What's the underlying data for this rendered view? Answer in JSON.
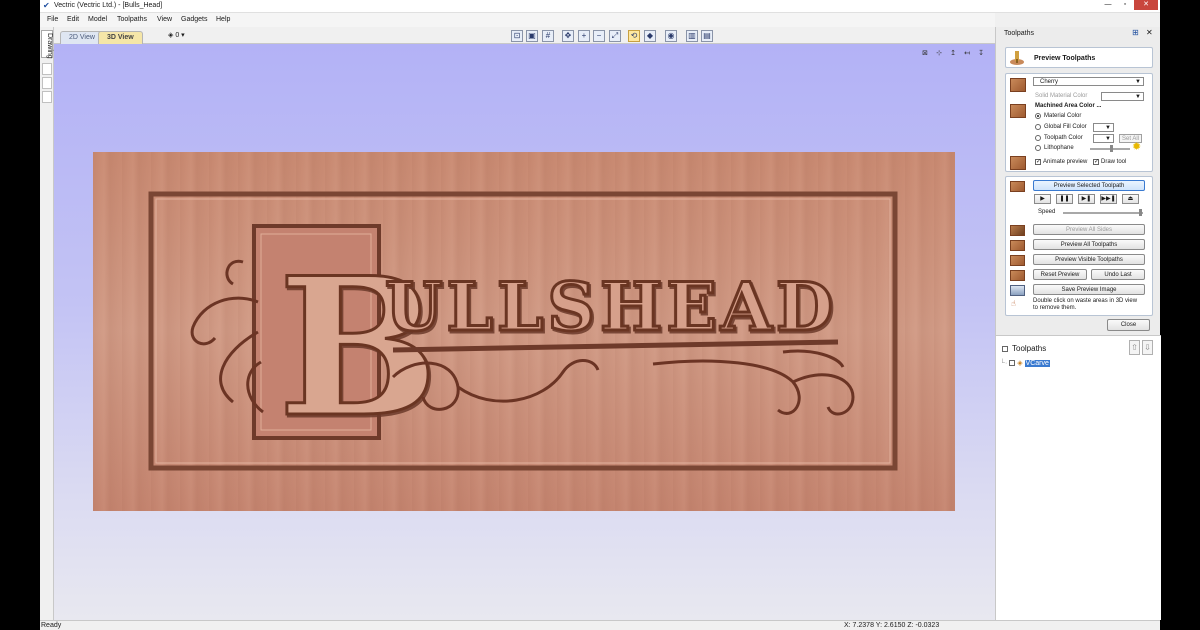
{
  "window": {
    "title": "Vectric (Vectric Ltd.) - [Bulls_Head]",
    "controls": {
      "minimize": "—",
      "maximize": "▫",
      "close": "✕"
    }
  },
  "menu": [
    "File",
    "Edit",
    "Model",
    "Toolpaths",
    "View",
    "Gadgets",
    "Help"
  ],
  "left_strip": {
    "drawing_tab": "Drawing"
  },
  "view_tabs": {
    "tab_2d": "2D View",
    "tab_3d": "3D View",
    "layer_selector": "0"
  },
  "viewport": {
    "sign_text": "BULLS HEAD",
    "material_color": "#cf9580"
  },
  "status": {
    "text": "Ready",
    "coords": "X: 7.2378 Y: 2.6150 Z: -0.0323"
  },
  "panel": {
    "header": "Toolpaths",
    "preview_title": "Preview Toolpaths",
    "material": {
      "material_value": "Cherry",
      "solid_material_color": "Solid Material Color",
      "machined_area_label": "Machined Area Color ...",
      "options": [
        "Material Color",
        "Global Fill Color",
        "Toolpath Color",
        "Lithophane"
      ],
      "selected_option": "Material Color",
      "set_all": "Set All",
      "animate_preview": "Animate preview",
      "draw_tool": "Draw tool"
    },
    "controls": {
      "preview_selected": "Preview Selected Toolpath",
      "speed_label": "Speed",
      "preview_all_sides": "Preview All Sides",
      "preview_all": "Preview All Toolpaths",
      "preview_visible": "Preview Visible Toolpaths",
      "reset_preview": "Reset Preview",
      "undo_last": "Undo Last",
      "save_preview_image": "Save Preview Image",
      "help_line1": "Double click on waste areas in 3D view",
      "help_line2": "to remove them."
    },
    "close": "Close",
    "toolpaths_section": {
      "title": "Toolpaths",
      "items": [
        {
          "name": "VCarve",
          "selected": true
        }
      ]
    }
  },
  "accent_colors": {
    "selection": "#3a7ad0",
    "close_button": "#c9463d"
  }
}
